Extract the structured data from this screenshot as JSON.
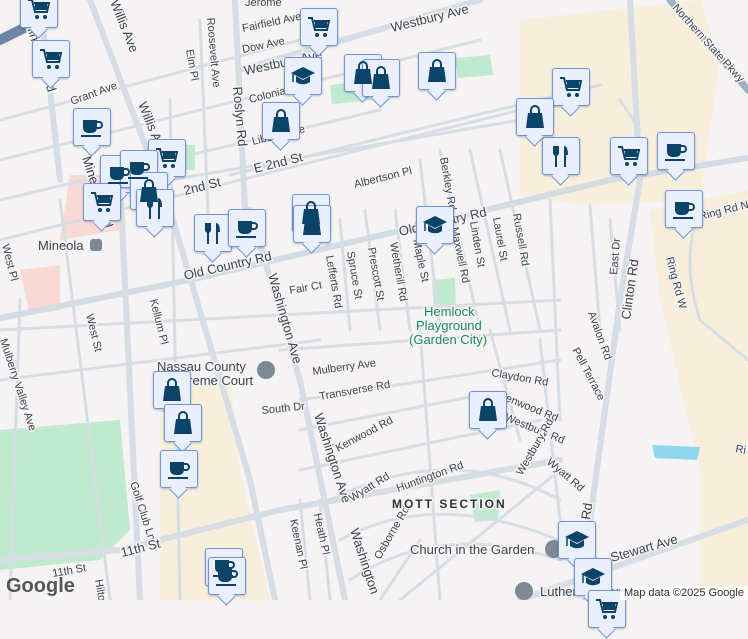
{
  "streets": {
    "westbury_ave": "Westbury Ave",
    "westbury_ave_2": "Westbury Ave",
    "fairfield": "Fairfield Ave",
    "dow": "Dow Ave",
    "jerome": "Jerome",
    "colonial": "Colonial",
    "liberty": "Liberty Ave",
    "e2nd": "E 2nd St",
    "second": "2nd St",
    "albertson": "Albertson Pl",
    "old_country": "Old Country Rd",
    "old_country_2": "Old Country Rd",
    "willis": "Willis Ave",
    "willis_2": "Willis Ave",
    "mineola_blvd": "Mineola Blvd",
    "mineola_blvd_2": "Mineola Blvd",
    "grant": "Grant Ave",
    "elm": "Elm Pl",
    "roosevelt": "Roosevelt Ave",
    "roslyn": "Roslyn Rd",
    "berkley": "Berkley Rd",
    "linden": "Linden St",
    "laurel": "Laurel St",
    "russell": "Russell Rd",
    "maxwell": "Maxwell Rd",
    "maple": "Maple St",
    "wetherill": "Wetherill Rd",
    "prescott": "Prescott St",
    "spruce": "Spruce St",
    "lefferts": "Lefferts Rd",
    "fair": "Fair Ct",
    "washington": "Washington Ave",
    "washington_2": "Washington Ave",
    "washington_3": "Washington",
    "kellum": "Kellum Pl",
    "west_st": "West St",
    "west_pl": "West Pl",
    "mulberry": "Mulberry Ave",
    "transverse": "Transverse Rd",
    "south_dr": "South Dr",
    "kenwood": "Kenwood Rd",
    "kenwood_2": "Kenwood Rd",
    "claydon": "Claydon Rd",
    "westbury_rd": "Westbury Rd",
    "westbury_rd_2": "Westbury Rd",
    "wyatt": "Wyatt Rd",
    "wyatt_2": "Wyatt Rd",
    "huntington": "Huntington Rd",
    "osborne": "Osborne Rd",
    "clinton": "Clinton Rd",
    "clinton_2": "Rd",
    "east_dr": "East Dr",
    "avalon": "Avalon Rd",
    "pell": "Pell Terrace",
    "ring_w": "Ring Rd W",
    "ring_n": "Ring Rd N",
    "ring_e": "Ri",
    "golf": "Golf Club Ln",
    "eleventh": "11th St",
    "eleventh_2": "11th St",
    "keenan": "Keenan Pl",
    "heath": "Heath Pl",
    "hilton": "Hilton",
    "stewart": "Stewart Ave",
    "parkway": "Northern State Pkwy",
    "valley": "Mulberry Valley Ave"
  },
  "places": {
    "mineola": "Mineola",
    "court_1": "Nassau County",
    "court_2": "Supreme Court",
    "hemlock_1": "Hemlock",
    "hemlock_2": "Playground",
    "hemlock_3": "(Garden City)",
    "mott": "MOTT SECTION",
    "church": "Church in the Garden",
    "lutheran": "Lutheran Church"
  },
  "pins": [
    "cart",
    "cart",
    "cart",
    "graduation-cap",
    "shopping-bag",
    "shopping-bag",
    "shopping-bag",
    "shopping-bag",
    "coffee",
    "cart",
    "coffee",
    "coffee",
    "shopping-bag",
    "cart",
    "restaurant",
    "restaurant",
    "coffee",
    "shopping-bag",
    "shopping-bag",
    "cart",
    "shopping-bag",
    "restaurant",
    "cart",
    "coffee",
    "coffee",
    "graduation-cap",
    "shopping-bag",
    "shopping-bag",
    "coffee",
    "shopping-bag",
    "coffee",
    "coffee",
    "graduation-cap",
    "graduation-cap",
    "cart"
  ],
  "footer": {
    "google": "Google",
    "attribution": "Map data ©2025 Google"
  },
  "colors": {
    "background": "#f5f3f3",
    "road": "#d6dde4",
    "commercial": "#f7efdc",
    "park": "#bfead0",
    "water": "#8fd6ee",
    "pin_fill": "#e9effd",
    "pin_icon": "#0b4466"
  }
}
